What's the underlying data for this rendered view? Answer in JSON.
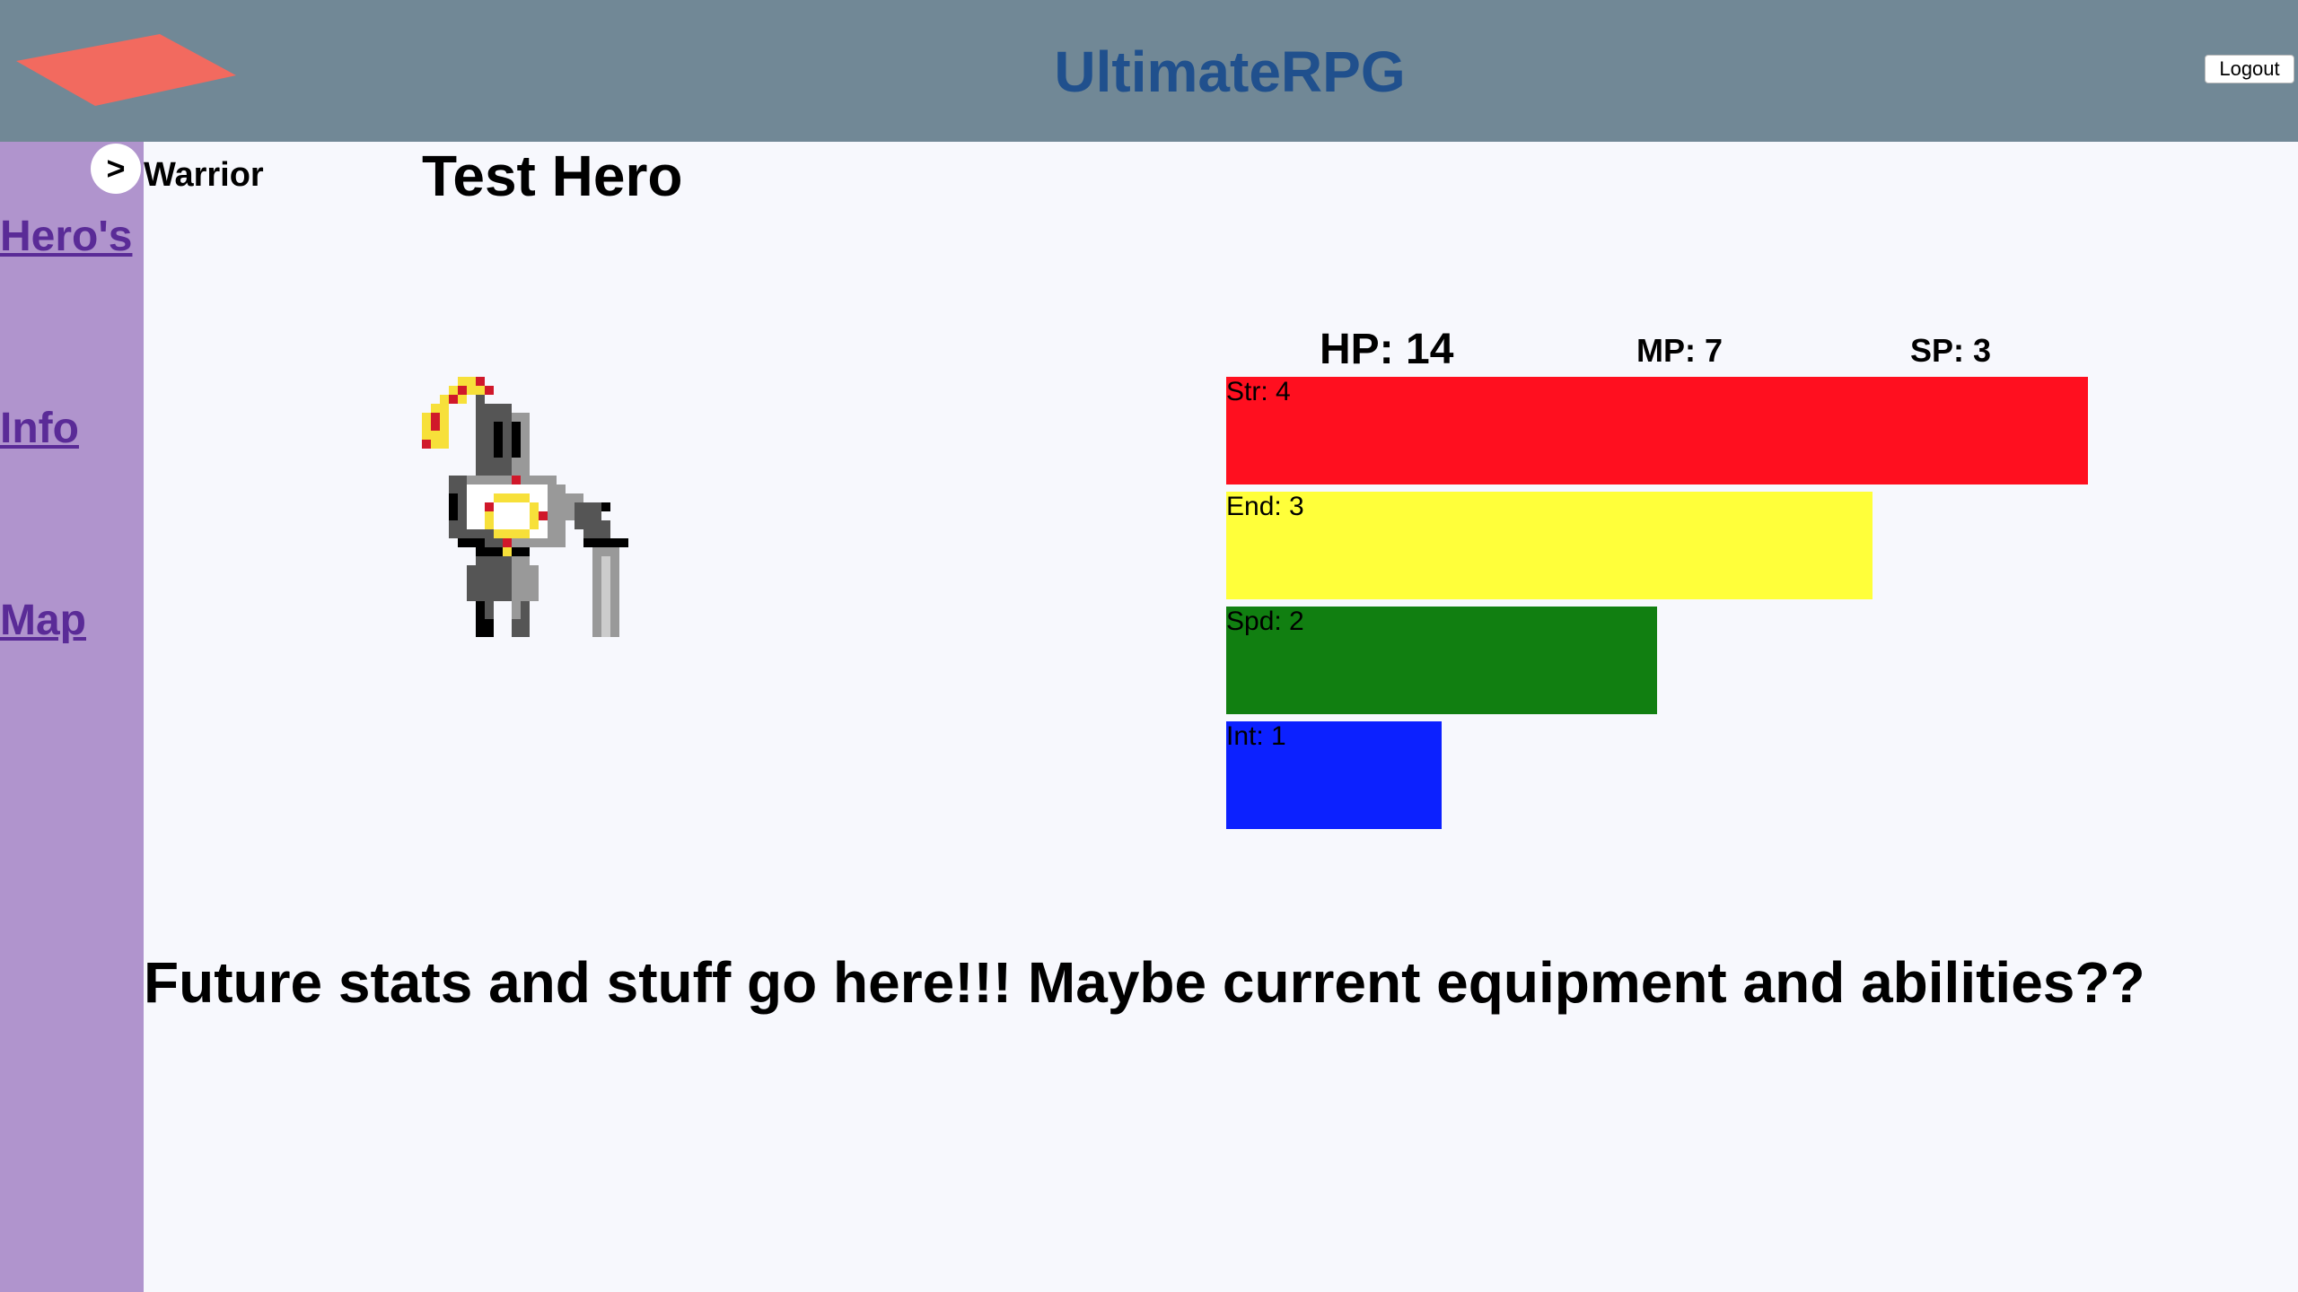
{
  "header": {
    "title": "UltimateRPG",
    "logout_label": "Logout",
    "logo_color": "#f26a5f",
    "background": "#718896"
  },
  "sidebar": {
    "toggle_label": ">",
    "class_label": "Warrior",
    "items": [
      {
        "label": "Hero's"
      },
      {
        "label": "Info"
      },
      {
        "label": "Map"
      }
    ],
    "background": "#b094cd",
    "link_color": "#5a2b97"
  },
  "hero": {
    "name": "Test Hero",
    "class": "Warrior"
  },
  "stats": {
    "hp": "HP: 14",
    "mp": "MP: 7",
    "sp": "SP: 3",
    "bars": [
      {
        "label": "Str: 4",
        "value": 4,
        "max": 4,
        "color": "#ff0f1f"
      },
      {
        "label": "End: 3",
        "value": 3,
        "max": 4,
        "color": "#ffff3a"
      },
      {
        "label": "Spd: 2",
        "value": 2,
        "max": 4,
        "color": "#117f11"
      },
      {
        "label": "Int: 1",
        "value": 1,
        "max": 4,
        "color": "#0c21ff"
      }
    ]
  },
  "footer_note": "Future stats and stuff go here!!! Maybe current equipment and abilities??"
}
